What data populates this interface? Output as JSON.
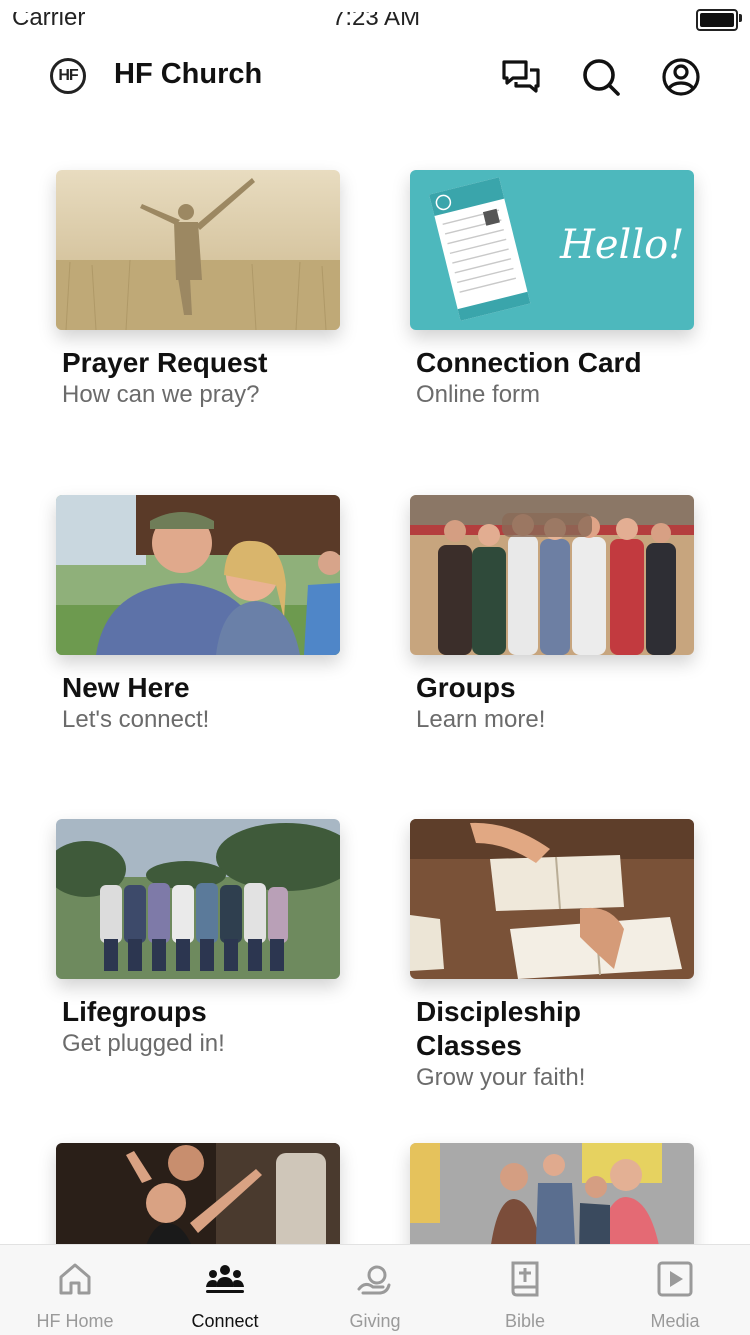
{
  "status": {
    "carrier": "Carrier",
    "time": "7:23 AM"
  },
  "header": {
    "logo_text": "HF",
    "title": "HF Church",
    "icons": [
      "chat-icon",
      "search-icon",
      "profile-icon"
    ]
  },
  "cards": [
    {
      "title": "Prayer Request",
      "subtitle": "How can we pray?"
    },
    {
      "title": "Connection Card",
      "subtitle": "Online form",
      "image_text": "Hello!"
    },
    {
      "title": "New Here",
      "subtitle": "Let's connect!"
    },
    {
      "title": "Groups",
      "subtitle": "Learn more!"
    },
    {
      "title": "Lifegroups",
      "subtitle": "Get plugged in!"
    },
    {
      "title_line1": "Discipleship",
      "title_line2": "Classes",
      "subtitle": "Grow your faith!"
    },
    {
      "title": ""
    },
    {
      "title": ""
    }
  ],
  "tabs": [
    {
      "label": "HF Home",
      "icon": "home-icon"
    },
    {
      "label": "Connect",
      "icon": "people-icon",
      "active": true
    },
    {
      "label": "Giving",
      "icon": "giving-icon"
    },
    {
      "label": "Bible",
      "icon": "bible-icon"
    },
    {
      "label": "Media",
      "icon": "play-icon"
    }
  ],
  "colors": {
    "accent": "#111111",
    "inactive": "#9a9a9a",
    "teal": "#4db8bd"
  }
}
